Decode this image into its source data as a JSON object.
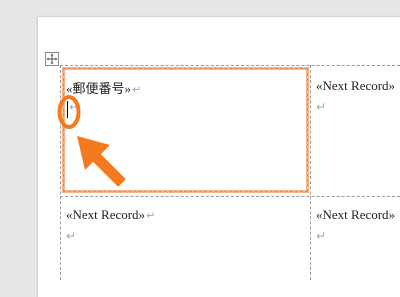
{
  "table": {
    "cells": [
      {
        "text": "«郵便番号»",
        "para_mark": "↵"
      },
      {
        "text": "«Next Record»",
        "para_mark": "↵"
      },
      {
        "text": "«Next Record»",
        "para_mark": "↵"
      },
      {
        "text": "«Next Record»",
        "para_mark": "↵"
      }
    ]
  },
  "annotation": {
    "color": "#f47a20",
    "icons": [
      "highlight-circle-icon",
      "pointer-arrow-icon"
    ]
  },
  "icons": {
    "move_handle": "four-way-arrow-icon"
  }
}
